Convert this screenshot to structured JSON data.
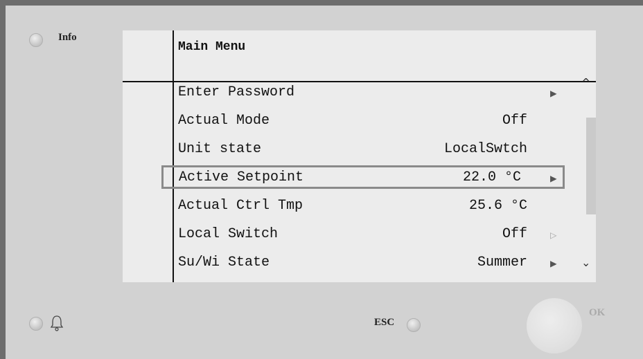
{
  "controls": {
    "info_label": "Info",
    "esc_label": "ESC",
    "ok_label": "OK"
  },
  "screen": {
    "title": "Main Menu",
    "items": [
      {
        "label": "Enter Password",
        "value": "",
        "arrow": "▶"
      },
      {
        "label": "Actual Mode",
        "value": "Off",
        "arrow": ""
      },
      {
        "label": "Unit state",
        "value": "LocalSwtch",
        "arrow": ""
      },
      {
        "label": "Active Setpoint",
        "value": "22.0 °C",
        "arrow": "▶"
      },
      {
        "label": "Actual Ctrl Tmp",
        "value": "25.6 °C",
        "arrow": ""
      },
      {
        "label": "Local Switch",
        "value": "Off",
        "arrow": "▷"
      },
      {
        "label": "Su/Wi State",
        "value": "Summer",
        "arrow": "▶"
      }
    ],
    "scroll_up": "^",
    "scroll_down": "⌄"
  },
  "icons": {
    "bell": "bell-icon"
  }
}
